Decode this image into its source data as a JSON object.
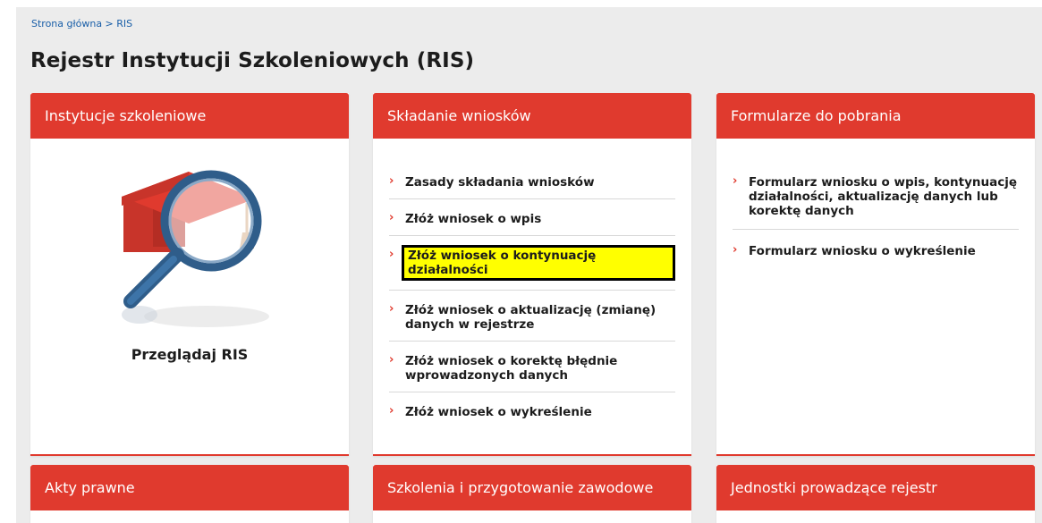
{
  "breadcrumb": {
    "home": "Strona główna",
    "separator": " > ",
    "current": "RIS"
  },
  "page_title": "Rejestr Instytucji Szkoleniowych (RIS)",
  "cards": {
    "institutions": {
      "title": "Instytucje szkoleniowe",
      "browse": "Przeglądaj RIS"
    },
    "applications": {
      "title": "Składanie wniosków",
      "items": [
        "Zasady składania wniosków",
        "Złóż wniosek o wpis",
        "Złóż wniosek o kontynuację działalności",
        "Złóż wniosek o aktualizację (zmianę) danych w rejestrze",
        "Złóż wniosek o korektę błędnie wprowadzonych danych",
        "Złóż wniosek o wykreślenie"
      ]
    },
    "forms": {
      "title": "Formularze do pobrania",
      "items": [
        "Formularz wniosku o wpis, kontynuację działalności, aktualizację danych lub korektę danych",
        "Formularz wniosku o wykreślenie"
      ]
    },
    "legal": {
      "title": "Akty prawne"
    },
    "training": {
      "title": "Szkolenia i przygotowanie zawodowe"
    },
    "units": {
      "title": "Jednostki prowadzące rejestr"
    }
  },
  "colors": {
    "accent": "#e03a2e",
    "highlight": "#ffff00",
    "link": "#1a5fa8"
  },
  "icons": {
    "chevron": "›"
  }
}
